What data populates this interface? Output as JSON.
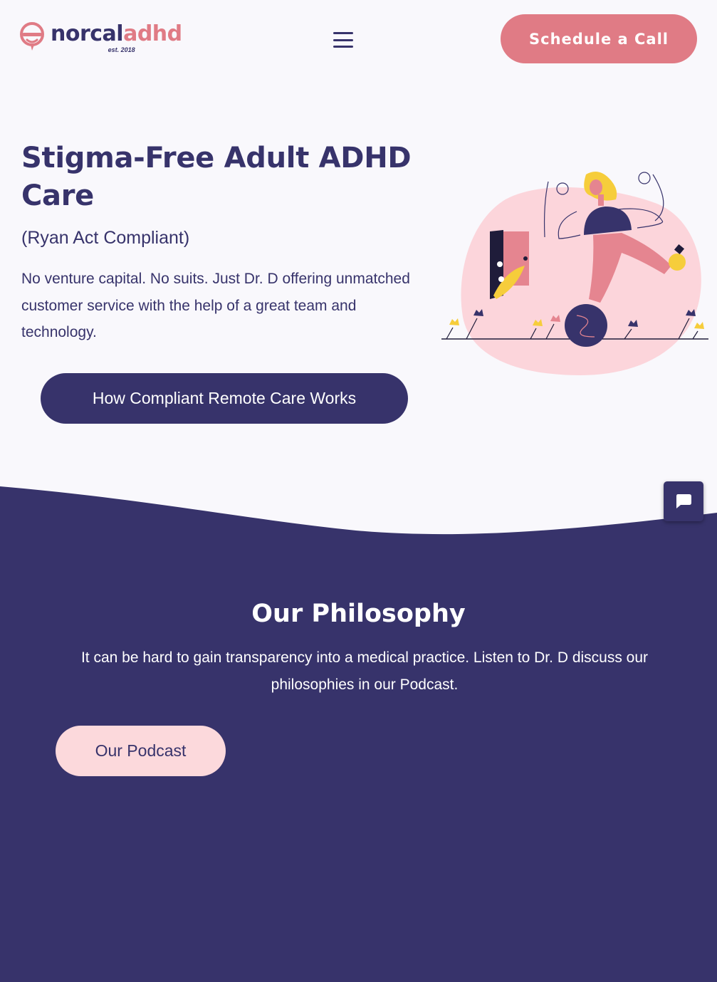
{
  "header": {
    "logo_part1": "norcal",
    "logo_part2": "adhd",
    "logo_tagline": "est. 2018",
    "menu_icon": "hamburger-icon",
    "schedule_label": "Schedule a Call"
  },
  "hero": {
    "title": "Stigma-Free Adult ADHD Care",
    "subtitle": "(Ryan Act Compliant)",
    "description": "No venture capital. No suits. Just Dr. D offering unmatched customer service with the help of a great team and technology.",
    "cta_label": "How Compliant Remote Care Works"
  },
  "philosophy": {
    "title": "Our Philosophy",
    "text": "It can be hard to gain transparency into a medical practice. Listen to Dr. D discuss our philosophies in our Podcast.",
    "button_label": "Our Podcast"
  },
  "chat_widget": {
    "icon": "chat-bubble-icon"
  },
  "colors": {
    "primary": "#37336b",
    "accent": "#e07b85",
    "accent_light": "#fcd9dc",
    "background": "#f9f8fc"
  }
}
